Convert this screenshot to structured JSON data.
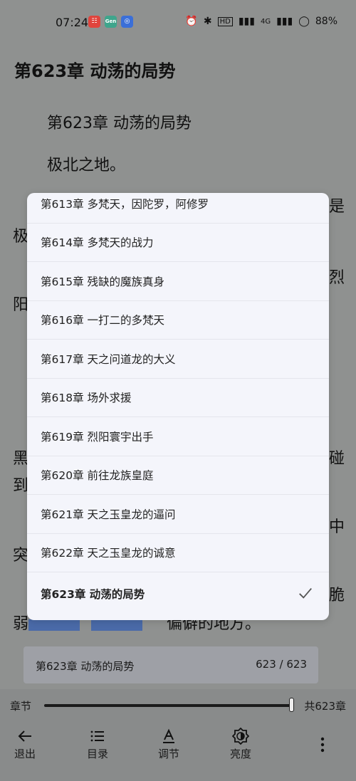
{
  "status": {
    "time": "07:24",
    "apps": [
      {
        "text": "☷",
        "color": "#e0443d"
      },
      {
        "text": "Gen",
        "color": "#3fa58c"
      },
      {
        "text": "◎",
        "color": "#3b6fd8"
      }
    ],
    "battery": "88%",
    "hd_label": "HD",
    "signal_label": "4G"
  },
  "reader": {
    "header_title": "第623章 动荡的局势",
    "chapter_heading": "第623章 动荡的局势",
    "first_line": "极北之地。",
    "partial_left": [
      "极",
      "阳",
      "黑",
      "到",
      "突",
      "弱"
    ],
    "partial_right": [
      "是",
      "烈",
      "碰",
      "中",
      "脆"
    ],
    "bottom_line": "偏僻的地方。"
  },
  "chapter_popup": {
    "items": [
      {
        "label": "第613章 多梵天，因陀罗，阿修罗",
        "current": false
      },
      {
        "label": "第614章 多梵天的战力",
        "current": false
      },
      {
        "label": "第615章 残缺的魔族真身",
        "current": false
      },
      {
        "label": "第616章 一打二的多梵天",
        "current": false
      },
      {
        "label": "第617章 天之问道龙的大义",
        "current": false
      },
      {
        "label": "第618章 场外求援",
        "current": false
      },
      {
        "label": "第619章 烈阳寰宇出手",
        "current": false
      },
      {
        "label": "第620章 前往龙族皇庭",
        "current": false
      },
      {
        "label": "第621章 天之玉皇龙的逼问",
        "current": false
      },
      {
        "label": "第622章 天之玉皇龙的诚意",
        "current": false
      },
      {
        "label": "第623章 动荡的局势",
        "current": true
      }
    ]
  },
  "progress_card": {
    "title": "第623章 动荡的局势",
    "count": "623 / 623"
  },
  "slider": {
    "left_label": "章节",
    "right_label": "共623章",
    "progress": 1.0
  },
  "toolbar": {
    "exit_label": "退出",
    "toc_label": "目录",
    "adjust_label": "调节",
    "brightness_label": "亮度"
  }
}
